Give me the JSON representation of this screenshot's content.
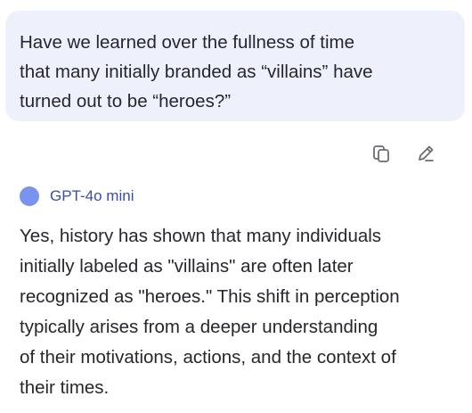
{
  "user_message": {
    "text": "Have we learned over the fullness of time\nthat many initially branded as “villains” have\nturned out to be “heroes?”"
  },
  "message_actions": {
    "copy_icon": "copy-icon",
    "edit_icon": "edit-pencil-icon"
  },
  "assistant": {
    "model_name": "GPT-4o mini",
    "avatar_color": "#7b93f0",
    "text": "Yes, history has shown that many individuals\ninitially labeled as \"villains\" are often later\nrecognized as \"heroes.\" This shift in perception\ntypically arises from a deeper understanding\nof their motivations, actions, and the context of\ntheir times."
  },
  "colors": {
    "user_bubble_bg": "#eef0fb",
    "model_name": "#3a4ea3",
    "icon": "#6b6b72"
  }
}
